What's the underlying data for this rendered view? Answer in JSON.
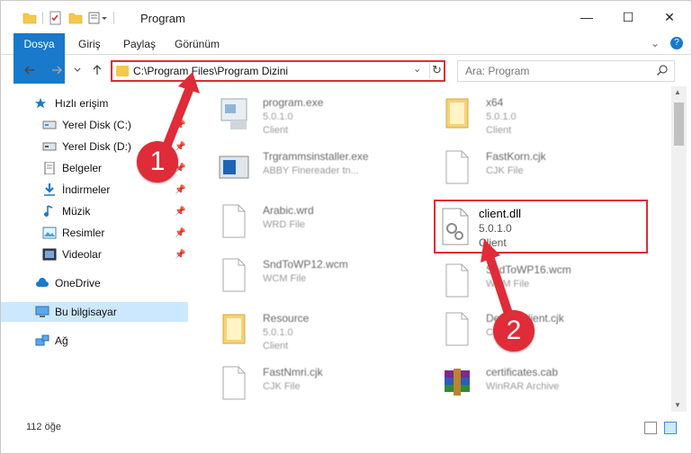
{
  "window": {
    "title": "Program",
    "controls": {
      "minimize": "—",
      "maximize": "☐",
      "close": "✕"
    }
  },
  "ribbon": {
    "tabs": [
      "Dosya",
      "Giriş",
      "Paylaş",
      "Görünüm"
    ],
    "expand": "⌄",
    "help": "?"
  },
  "address": {
    "path": "C:\\Program Files\\Program Dizini",
    "search_placeholder": "Ara: Program"
  },
  "nav": {
    "items": [
      {
        "label": "Hızlı erişim",
        "icon": "star-icon"
      },
      {
        "label": "Yerel Disk (C:)",
        "icon": "drive-icon"
      },
      {
        "label": "Yerel Disk (D:)",
        "icon": "drive-icon"
      },
      {
        "label": "Belgeler",
        "icon": "document-icon"
      },
      {
        "label": "İndirmeler",
        "icon": "download-icon"
      },
      {
        "label": "Müzik",
        "icon": "music-icon"
      },
      {
        "label": "Resimler",
        "icon": "pictures-icon"
      },
      {
        "label": "Videolar",
        "icon": "video-icon"
      },
      {
        "label": "OneDrive",
        "icon": "cloud-icon"
      },
      {
        "label": "Bu bilgisayar",
        "icon": "computer-icon"
      },
      {
        "label": "Ağ",
        "icon": "network-icon"
      }
    ]
  },
  "files": [
    {
      "name": "program.exe",
      "line2": "5.0.1.0",
      "line3": "Client",
      "icon": "exe-icon"
    },
    {
      "name": "x64",
      "line2": "5.0.1.0",
      "line3": "Client",
      "icon": "folder-icon"
    },
    {
      "name": "Trgrammsinstaller.exe",
      "line2": "ABBY Finereader tn...",
      "line3": "",
      "icon": "installer-icon"
    },
    {
      "name": "FastKorn.cjk",
      "line2": "CJK File",
      "line3": "",
      "icon": "file-icon"
    },
    {
      "name": "Arabic.wrd",
      "line2": "WRD File",
      "line3": "",
      "icon": "file-icon"
    },
    {
      "name": "client.dll",
      "line2": "5.0.1.0",
      "line3": "Client",
      "icon": "dll-icon"
    },
    {
      "name": "SndToWP12.wcm",
      "line2": "WCM File",
      "line3": "",
      "icon": "file-icon"
    },
    {
      "name": "SndToWP16.wcm",
      "line2": "WCM File",
      "line3": "",
      "icon": "file-icon"
    },
    {
      "name": "Resource",
      "line2": "5.0.1.0",
      "line3": "Client",
      "icon": "folder-icon"
    },
    {
      "name": "DefaultClient.cjk",
      "line2": "CJK File",
      "line3": "",
      "icon": "file-icon"
    },
    {
      "name": "FastNmri.cjk",
      "line2": "CJK File",
      "line3": "",
      "icon": "file-icon"
    },
    {
      "name": "certificates.cab",
      "line2": "WinRAR Archive",
      "line3": "",
      "icon": "archive-icon"
    }
  ],
  "status": {
    "count": "112 öğe"
  },
  "annotations": {
    "step1": "1",
    "step2": "2"
  },
  "colors": {
    "accent": "#1979ca",
    "highlight": "#e02b38",
    "selected": "#cce8ff"
  }
}
